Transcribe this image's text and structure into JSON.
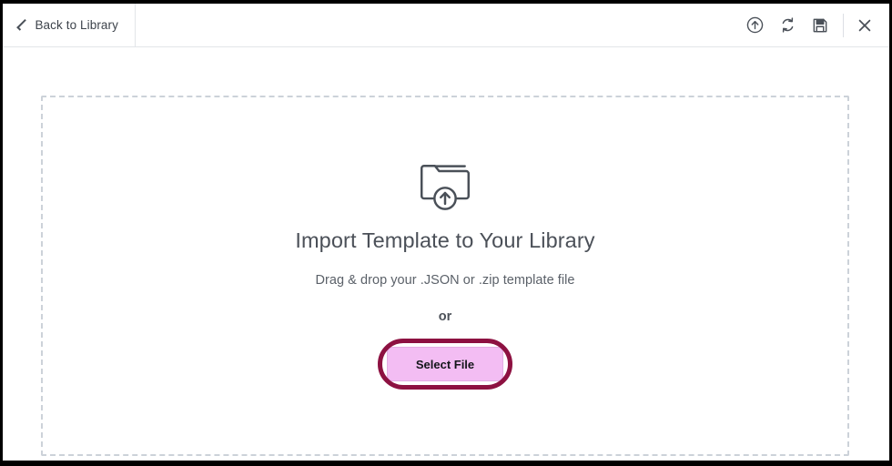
{
  "header": {
    "back": {
      "label": "Back to Library",
      "icon": "chevron-left-icon"
    },
    "actions": [
      {
        "name": "upload-button",
        "icon": "upload-circle-icon",
        "title": "Upload"
      },
      {
        "name": "refresh-button",
        "icon": "refresh-sync-icon",
        "title": "Refresh"
      },
      {
        "name": "save-button",
        "icon": "floppy-disk-save-icon",
        "title": "Save"
      },
      {
        "name": "close-button",
        "icon": "close-x-icon",
        "title": "Close"
      }
    ]
  },
  "dropzone": {
    "icon": "folder-upload-icon",
    "title": "Import Template to Your Library",
    "subtitle": "Drag & drop your .JSON or .zip template file",
    "or_label": "or",
    "select_file_label": "Select File"
  },
  "colors": {
    "highlight_ring": "#8d1141",
    "button_fill": "#f3bdf3",
    "dashed_border": "#ccd2d9",
    "text_primary": "#4b5058",
    "icon": "#4a5058"
  }
}
